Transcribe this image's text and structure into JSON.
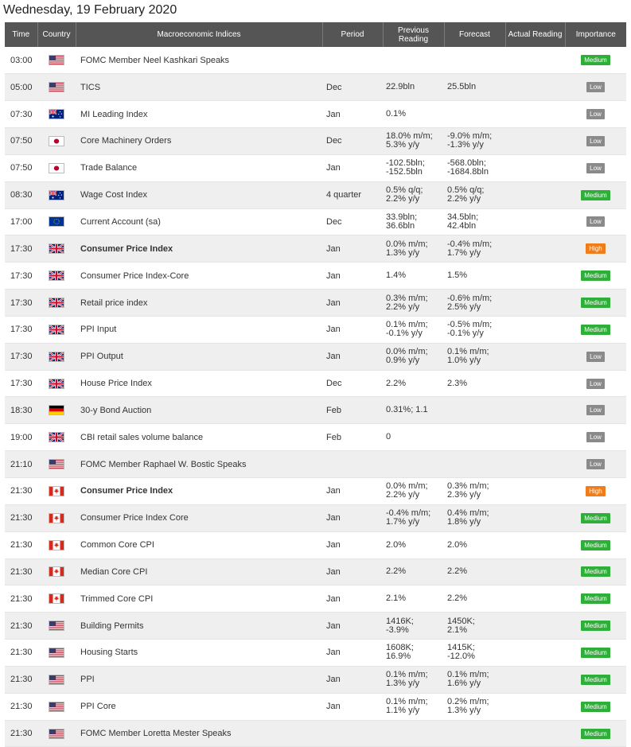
{
  "page": {
    "title": "Wednesday, 19 February 2020"
  },
  "table": {
    "headers": {
      "time": "Time",
      "country": "Country",
      "indices": "Macroeconomic Indices",
      "period": "Period",
      "previous_1": "Previous",
      "previous_2": "Reading",
      "forecast": "Forecast",
      "actual": "Actual Reading",
      "importance": "Importance"
    },
    "rows": [
      {
        "time": "03:00",
        "flag": "us-flag-icon",
        "name": "FOMC Member Neel Kashkari Speaks",
        "bold": false,
        "period": "",
        "prev": [],
        "fcst": [],
        "actual": "",
        "importance": "Medium"
      },
      {
        "time": "05:00",
        "flag": "us-flag-icon",
        "name": "TICS",
        "bold": false,
        "period": "Dec",
        "prev": [
          "22.9bln"
        ],
        "fcst": [
          "25.5bln"
        ],
        "actual": "",
        "importance": "Low"
      },
      {
        "time": "07:30",
        "flag": "au-flag-icon",
        "name": "MI Leading Index",
        "bold": false,
        "period": "Jan",
        "prev": [
          "0.1%"
        ],
        "fcst": [],
        "actual": "",
        "importance": "Low"
      },
      {
        "time": "07:50",
        "flag": "jp-flag-icon",
        "name": "Core Machinery Orders",
        "bold": false,
        "period": "Dec",
        "prev": [
          "18.0% m/m;",
          "5.3% y/y"
        ],
        "fcst": [
          "-9.0% m/m;",
          "-1.3% y/y"
        ],
        "actual": "",
        "importance": "Low"
      },
      {
        "time": "07:50",
        "flag": "jp-flag-icon",
        "name": "Trade Balance",
        "bold": false,
        "period": "Jan",
        "prev": [
          "-102.5bln;",
          "-152.5bln"
        ],
        "fcst": [
          "-568.0bln;",
          "-1684.8bln"
        ],
        "actual": "",
        "importance": "Low"
      },
      {
        "time": "08:30",
        "flag": "au-flag-icon",
        "name": "Wage Cost Index",
        "bold": false,
        "period": "4 quarter",
        "prev": [
          "0.5% q/q;",
          "2.2% y/y"
        ],
        "fcst": [
          "0.5% q/q;",
          "2.2% y/y"
        ],
        "actual": "",
        "importance": "Medium"
      },
      {
        "time": "17:00",
        "flag": "eu-flag-icon",
        "name": "Current Account (sa)",
        "bold": false,
        "period": "Dec",
        "prev": [
          "33.9bln;",
          "36.6bln"
        ],
        "fcst": [
          "34.5bln;",
          "42.4bln"
        ],
        "actual": "",
        "importance": "Low"
      },
      {
        "time": "17:30",
        "flag": "uk-flag-icon",
        "name": "Consumer Price Index",
        "bold": true,
        "period": "Jan",
        "prev": [
          "0.0% m/m;",
          "1.3% y/y"
        ],
        "fcst": [
          "-0.4% m/m;",
          "1.7% y/y"
        ],
        "actual": "",
        "importance": "High"
      },
      {
        "time": "17:30",
        "flag": "uk-flag-icon",
        "name": "Consumer Price Index-Core",
        "bold": false,
        "period": "Jan",
        "prev": [
          "1.4%"
        ],
        "fcst": [
          "1.5%"
        ],
        "actual": "",
        "importance": "Medium"
      },
      {
        "time": "17:30",
        "flag": "uk-flag-icon",
        "name": "Retail price index",
        "bold": false,
        "period": "Jan",
        "prev": [
          "0.3% m/m;",
          "2.2% y/y"
        ],
        "fcst": [
          "-0.6% m/m;",
          "2.5% y/y"
        ],
        "actual": "",
        "importance": "Medium"
      },
      {
        "time": "17:30",
        "flag": "uk-flag-icon",
        "name": "PPI Input",
        "bold": false,
        "period": "Jan",
        "prev": [
          "0.1% m/m;",
          "-0.1% y/y"
        ],
        "fcst": [
          "-0.5% m/m;",
          "-0.1% y/y"
        ],
        "actual": "",
        "importance": "Medium"
      },
      {
        "time": "17:30",
        "flag": "uk-flag-icon",
        "name": "PPI Output",
        "bold": false,
        "period": "Jan",
        "prev": [
          "0.0% m/m;",
          "0.9% y/y"
        ],
        "fcst": [
          "0.1% m/m;",
          "1.0% y/y"
        ],
        "actual": "",
        "importance": "Low"
      },
      {
        "time": "17:30",
        "flag": "uk-flag-icon",
        "name": "House Price Index",
        "bold": false,
        "period": "Dec",
        "prev": [
          "2.2%"
        ],
        "fcst": [
          "2.3%"
        ],
        "actual": "",
        "importance": "Low"
      },
      {
        "time": "18:30",
        "flag": "de-flag-icon",
        "name": "30-y Bond Auction",
        "bold": false,
        "period": "Feb",
        "prev": [
          "0.31%; 1.1"
        ],
        "fcst": [],
        "actual": "",
        "importance": "Low"
      },
      {
        "time": "19:00",
        "flag": "uk-flag-icon",
        "name": "CBI retail sales volume balance",
        "bold": false,
        "period": "Feb",
        "prev": [
          "0"
        ],
        "fcst": [],
        "actual": "",
        "importance": "Low"
      },
      {
        "time": "21:10",
        "flag": "us-flag-icon",
        "name": "FOMC Member Raphael W. Bostic Speaks",
        "bold": false,
        "period": "",
        "prev": [],
        "fcst": [],
        "actual": "",
        "importance": "Low"
      },
      {
        "time": "21:30",
        "flag": "ca-flag-icon",
        "name": "Consumer Price Index",
        "bold": true,
        "period": "Jan",
        "prev": [
          "0.0% m/m;",
          "2.2% y/y"
        ],
        "fcst": [
          "0.3% m/m;",
          "2.3% y/y"
        ],
        "actual": "",
        "importance": "High"
      },
      {
        "time": "21:30",
        "flag": "ca-flag-icon",
        "name": "Consumer Price Index Core",
        "bold": false,
        "period": "Jan",
        "prev": [
          "-0.4% m/m;",
          "1.7% y/y"
        ],
        "fcst": [
          "0.4% m/m;",
          "1.8% y/y"
        ],
        "actual": "",
        "importance": "Medium"
      },
      {
        "time": "21:30",
        "flag": "ca-flag-icon",
        "name": "Common Core CPI",
        "bold": false,
        "period": "Jan",
        "prev": [
          "2.0%"
        ],
        "fcst": [
          "2.0%"
        ],
        "actual": "",
        "importance": "Medium"
      },
      {
        "time": "21:30",
        "flag": "ca-flag-icon",
        "name": "Median Core CPI",
        "bold": false,
        "period": "Jan",
        "prev": [
          "2.2%"
        ],
        "fcst": [
          "2.2%"
        ],
        "actual": "",
        "importance": "Medium"
      },
      {
        "time": "21:30",
        "flag": "ca-flag-icon",
        "name": "Trimmed Core CPI",
        "bold": false,
        "period": "Jan",
        "prev": [
          "2.1%"
        ],
        "fcst": [
          "2.2%"
        ],
        "actual": "",
        "importance": "Medium"
      },
      {
        "time": "21:30",
        "flag": "us-flag-icon",
        "name": "Building Permits",
        "bold": false,
        "period": "Jan",
        "prev": [
          "1416K;",
          "-3.9%"
        ],
        "fcst": [
          "1450K;",
          "2.1%"
        ],
        "actual": "",
        "importance": "Medium"
      },
      {
        "time": "21:30",
        "flag": "us-flag-icon",
        "name": "Housing Starts",
        "bold": false,
        "period": "Jan",
        "prev": [
          "1608K;",
          "16.9%"
        ],
        "fcst": [
          "1415K;",
          "-12.0%"
        ],
        "actual": "",
        "importance": "Medium"
      },
      {
        "time": "21:30",
        "flag": "us-flag-icon",
        "name": "PPI",
        "bold": false,
        "period": "Jan",
        "prev": [
          "0.1% m/m;",
          "1.3% y/y"
        ],
        "fcst": [
          "0.1% m/m;",
          "1.6% y/y"
        ],
        "actual": "",
        "importance": "Medium"
      },
      {
        "time": "21:30",
        "flag": "us-flag-icon",
        "name": "PPI Core",
        "bold": false,
        "period": "Jan",
        "prev": [
          "0.1% m/m;",
          "1.1% y/y"
        ],
        "fcst": [
          "0.2% m/m;",
          "1.3% y/y"
        ],
        "actual": "",
        "importance": "Medium"
      },
      {
        "time": "21:30",
        "flag": "us-flag-icon",
        "name": "FOMC Member Loretta Mester Speaks",
        "bold": false,
        "period": "",
        "prev": [],
        "fcst": [],
        "actual": "",
        "importance": "Medium"
      }
    ]
  },
  "colors": {
    "header_bg": "#555555",
    "low": "#8a8a8a",
    "medium": "#2fae3a",
    "high": "#f07d1c"
  }
}
